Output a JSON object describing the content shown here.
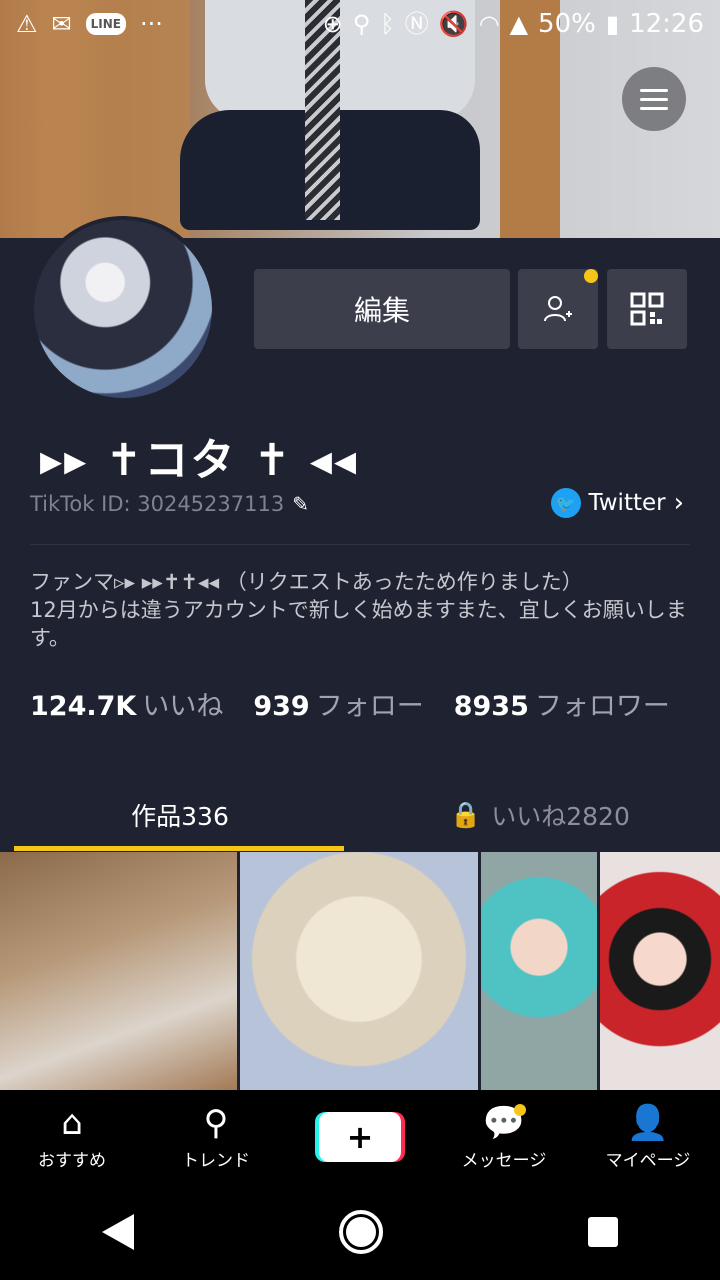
{
  "status_bar": {
    "line_label": "LINE",
    "dots": "···",
    "battery": "50%",
    "time": "12:26"
  },
  "profile": {
    "edit_label": "編集",
    "username": "▸▸ ✝コタ ✝ ◂◂",
    "tiktok_id": "TikTok ID: 30245237113",
    "twitter_label": "Twitter",
    "bio": "ファンマ▹▸ ▸▸✝✝◂◂ （リクエストあったため作りました）\n12月からは違うアカウントで新しく始めますまた、宜しくお願いします。",
    "stats": [
      {
        "value": "124.7K",
        "label": "いいね"
      },
      {
        "value": "939",
        "label": "フォロー"
      },
      {
        "value": "8935",
        "label": "フォロワー"
      }
    ]
  },
  "tabs": {
    "works": "作品336",
    "likes": "いいね2820"
  },
  "bottom_nav": {
    "home": "おすすめ",
    "trend": "トレンド",
    "plus": "+",
    "messages": "メッセージ",
    "mypage": "マイページ"
  },
  "colors": {
    "accent": "#f5c518",
    "panel": "#1f2230",
    "twitter": "#1da1f2"
  }
}
